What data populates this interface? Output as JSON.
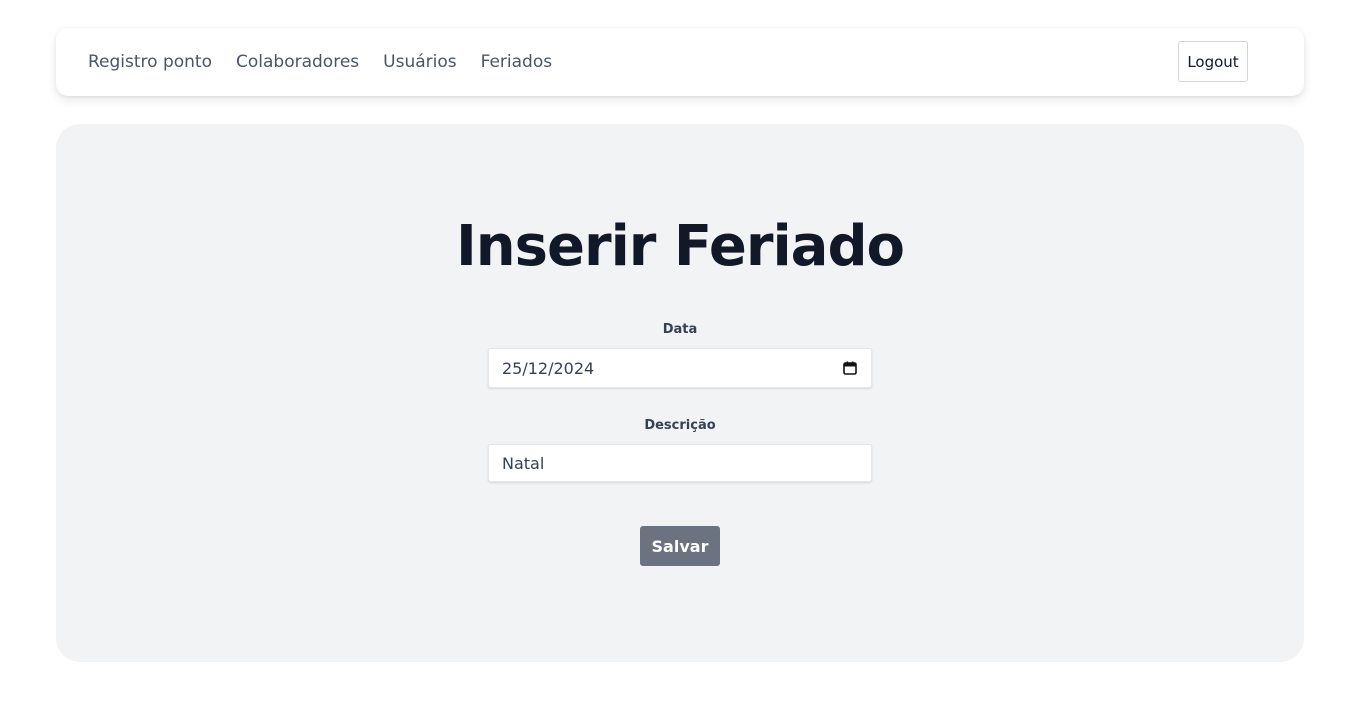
{
  "nav": {
    "items": [
      {
        "label": "Registro ponto"
      },
      {
        "label": "Colaboradores"
      },
      {
        "label": "Usuários"
      },
      {
        "label": "Feriados"
      }
    ],
    "logout_label": "Logout"
  },
  "form": {
    "title": "Inserir Feriado",
    "date_label": "Data",
    "date_value": "25/12/2024",
    "description_label": "Descrição",
    "description_value": "Natal",
    "save_label": "Salvar"
  },
  "icons": {
    "date_picker": "calendar-icon"
  },
  "colors": {
    "panel_background": "#f2f3f5",
    "save_button": "#6b7280",
    "title_text": "#111827"
  }
}
